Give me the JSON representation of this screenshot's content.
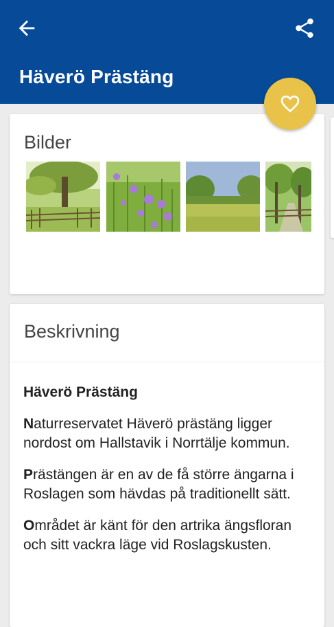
{
  "header": {
    "title": "Häverö Prästäng",
    "back_icon": "arrow-left-icon",
    "share_icon": "share-icon",
    "background_color": "#064a98"
  },
  "favorite": {
    "icon": "heart-outline-icon",
    "color": "#e9c24a"
  },
  "images_section": {
    "heading": "Bilder",
    "images": [
      {
        "subject": "tree-with-wooden-fence"
      },
      {
        "subject": "purple-meadow-flowers"
      },
      {
        "subject": "open-meadow-with-trees"
      },
      {
        "subject": "forest-path-with-fence"
      }
    ]
  },
  "description_section": {
    "heading": "Beskrivning",
    "title": "Häverö Prästäng",
    "paragraphs": [
      {
        "initial": "N",
        "rest": "aturreservatet Häverö prästäng ligger nordost om Hallstavik i Norrtälje kommun."
      },
      {
        "initial": "P",
        "rest": "rästängen är en av de få större ängarna i Roslagen som hävdas på traditionellt sätt."
      },
      {
        "initial": "O",
        "rest": "mrådet är känt för den artrika ängsfloran och sitt vackra läge vid Roslagskusten."
      }
    ]
  }
}
